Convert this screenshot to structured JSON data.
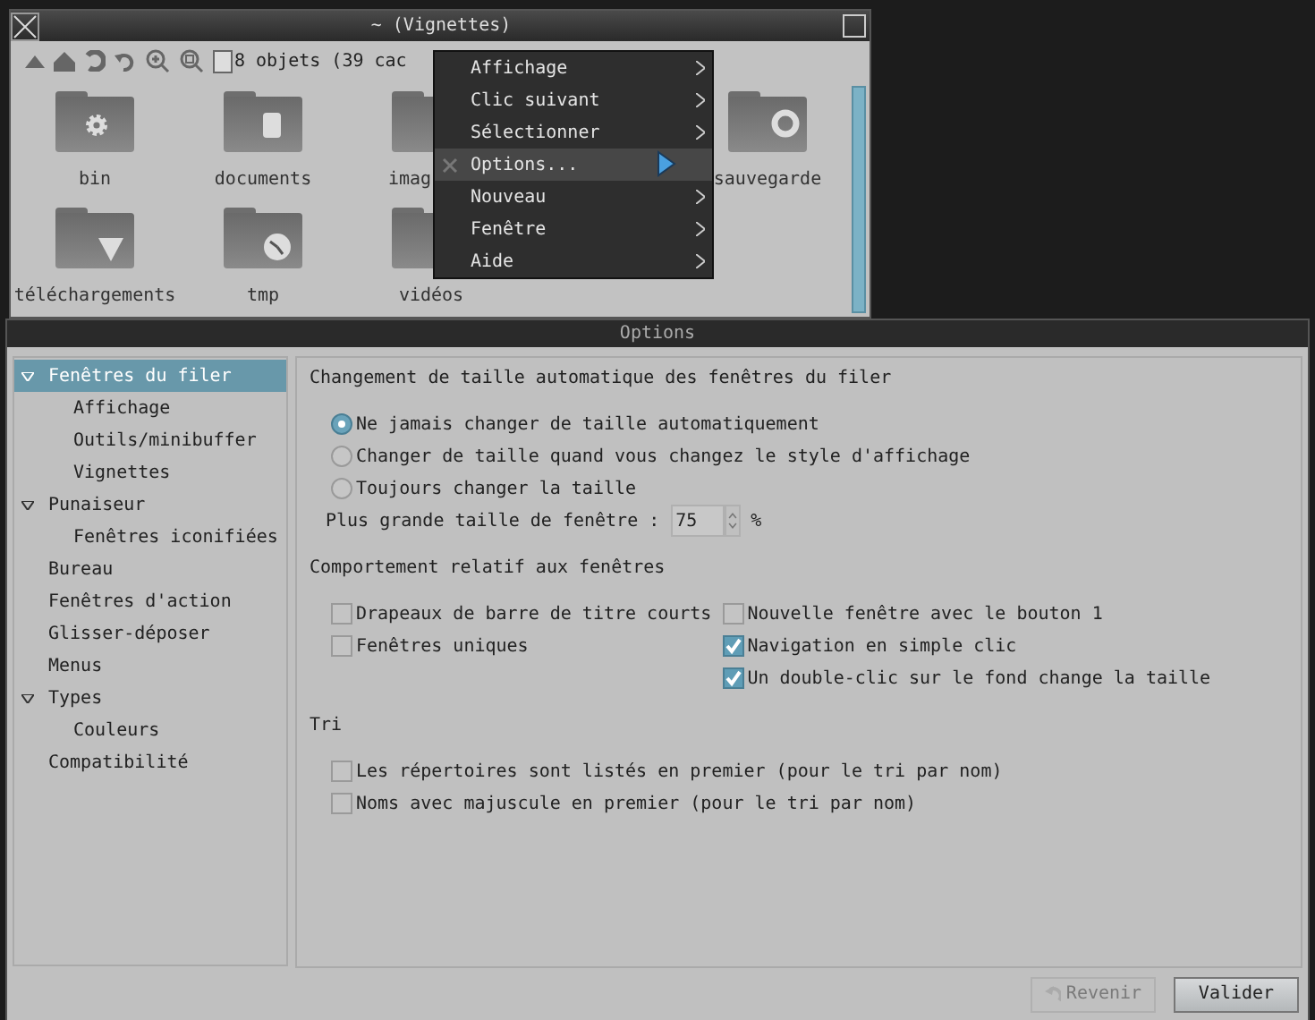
{
  "filer": {
    "title": "~ (Vignettes)",
    "select_all": {
      "checked": false
    },
    "status": "8 objets (39 cac",
    "rows": [
      [
        {
          "label": "bin",
          "kind": "gear"
        },
        {
          "label": "documents",
          "kind": "notebook"
        },
        {
          "label": "imag"
        },
        {
          "label": "sauvegarde",
          "kind": "ring"
        }
      ],
      [
        {
          "label": "téléchargements",
          "kind": "triangle"
        },
        {
          "label": "tmp",
          "kind": "clock"
        },
        {
          "label": "vidéos"
        }
      ]
    ]
  },
  "menu": {
    "items": [
      {
        "label": "Affichage",
        "submenu": true,
        "selected": false
      },
      {
        "label": "Clic suivant",
        "submenu": true,
        "selected": false
      },
      {
        "label": "Sélectionner",
        "submenu": true,
        "selected": false
      },
      {
        "label": "Options...",
        "submenu": false,
        "selected": true
      },
      {
        "label": "Nouveau",
        "submenu": true,
        "selected": false
      },
      {
        "label": "Fenêtre",
        "submenu": true,
        "selected": false
      },
      {
        "label": "Aide",
        "submenu": true,
        "selected": false
      }
    ]
  },
  "options": {
    "title": "Options",
    "sidebar": {
      "items": [
        {
          "label": "Fenêtres du filer",
          "selected": true,
          "expanded": true,
          "children": [
            {
              "label": "Affichage",
              "selected": false
            },
            {
              "label": "Outils/minibuffer",
              "selected": false
            },
            {
              "label": "Vignettes",
              "selected": false
            }
          ]
        },
        {
          "label": "Punaiseur",
          "selected": false,
          "expanded": true,
          "children": [
            {
              "label": "Fenêtres iconifiées",
              "selected": false
            }
          ]
        },
        {
          "label": "Bureau",
          "selected": false
        },
        {
          "label": "Fenêtres d'action",
          "selected": false
        },
        {
          "label": "Glisser-déposer",
          "selected": false
        },
        {
          "label": "Menus",
          "selected": false
        },
        {
          "label": "Types",
          "selected": false,
          "expanded": true,
          "children": [
            {
              "label": "Couleurs",
              "selected": false
            }
          ]
        },
        {
          "label": "Compatibilité",
          "selected": false
        }
      ]
    },
    "sections": [
      {
        "title": "Changement de taille automatique des fenêtres du filer",
        "radios": [
          {
            "label": "Ne jamais changer de taille automatiquement",
            "selected": true
          },
          {
            "label": "Changer de taille quand vous changez le style d'affichage",
            "selected": false
          },
          {
            "label": "Toujours changer la taille",
            "selected": false
          }
        ],
        "spin": {
          "label": "Plus grande taille de fenêtre :",
          "value": "75",
          "unit": "%"
        }
      },
      {
        "title": "Comportement relatif aux fenêtres",
        "columns": [
          [
            {
              "label": "Drapeaux de barre de titre courts",
              "checked": false
            },
            {
              "label": "Fenêtres uniques",
              "checked": false
            }
          ],
          [
            {
              "label": "Nouvelle fenêtre avec le bouton 1",
              "checked": false
            },
            {
              "label": "Navigation en simple clic",
              "checked": true
            },
            {
              "label": "Un double-clic sur le fond change la taille",
              "checked": true
            }
          ]
        ]
      },
      {
        "title": "Tri",
        "columns": [
          [
            {
              "label": "Les répertoires sont listés en premier (pour le tri par nom)",
              "checked": false
            },
            {
              "label": "Noms avec majuscule en premier (pour le tri par nom)",
              "checked": false
            }
          ]
        ]
      }
    ],
    "buttons": [
      {
        "label": "Revenir",
        "disabled": true
      },
      {
        "label": "Valider",
        "disabled": false
      }
    ]
  }
}
